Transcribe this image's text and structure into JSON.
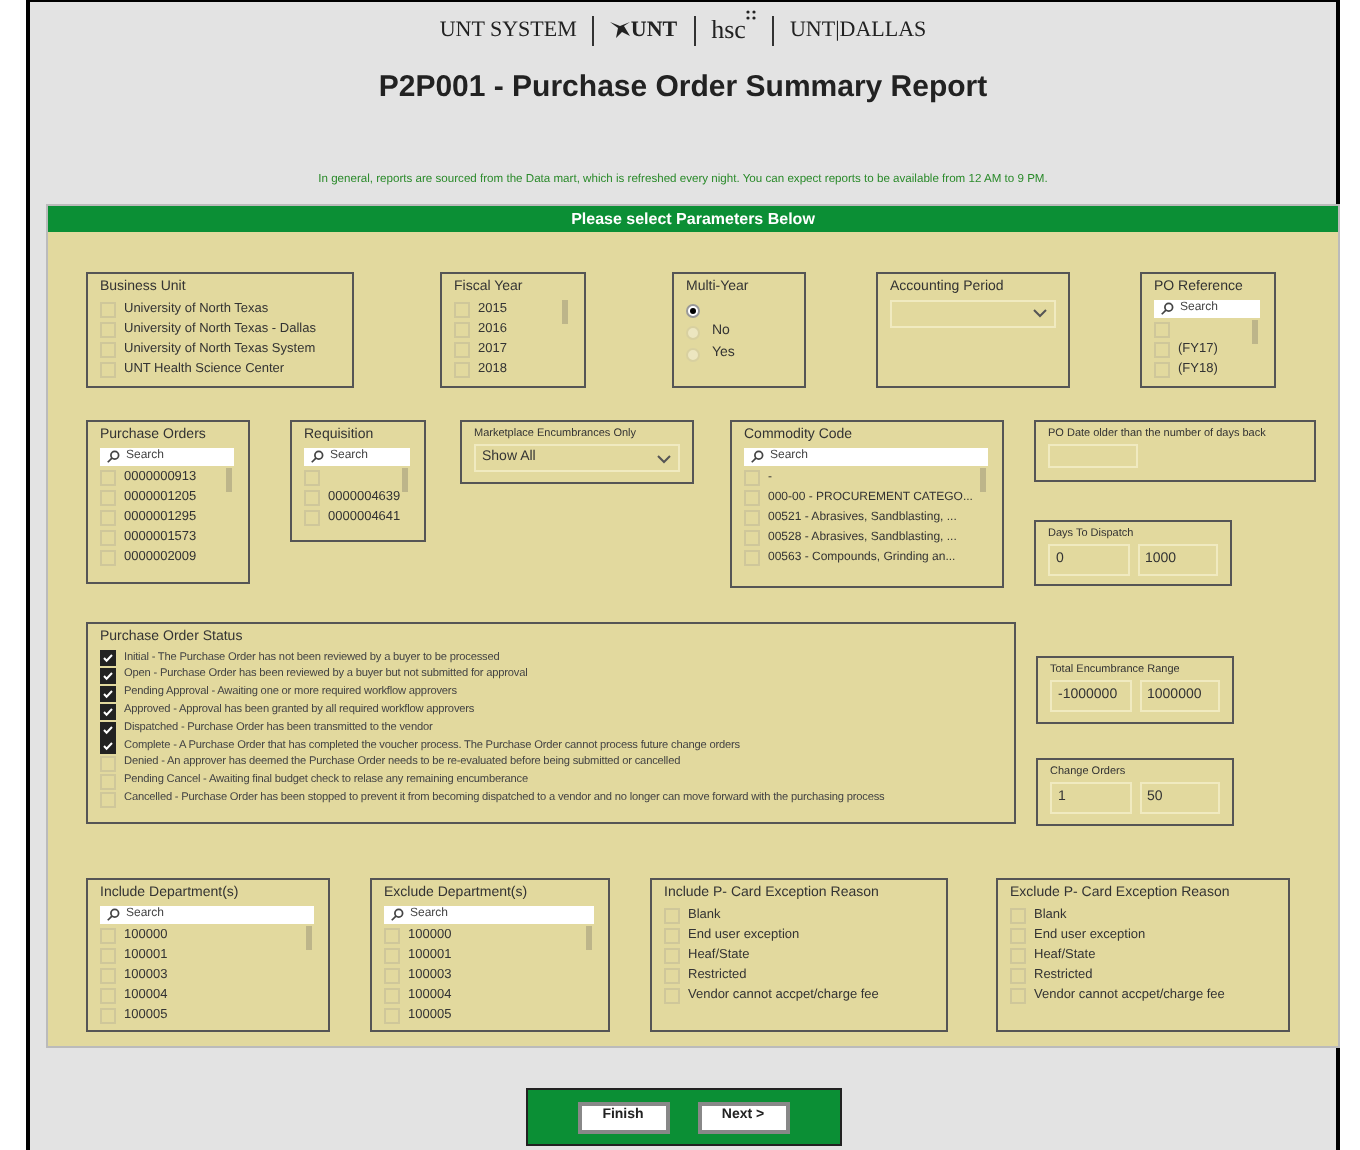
{
  "logos": [
    {
      "kind": "text",
      "text": "UNT SYSTEM"
    },
    {
      "kind": "eagle",
      "text": "UNT"
    },
    {
      "kind": "dots",
      "text": "hsc"
    },
    {
      "kind": "text",
      "text": "UNT|DALLAS"
    }
  ],
  "title": "P2P001 - Purchase Order Summary Report",
  "notice": "In general, reports are sourced from the Data mart, which is refreshed every night. You can expect reports to be available from 12 AM to 9 PM.",
  "panel": {
    "header": "Please select Parameters Below"
  },
  "rows": [
    [
      {
        "kind": "list",
        "title": "Business Unit",
        "items": [
          {
            "label": "University of North Texas",
            "checked": false
          },
          {
            "label": "University of North Texas - Dallas",
            "checked": false
          },
          {
            "label": "University of North Texas System",
            "checked": false
          },
          {
            "label": "UNT Health Science Center",
            "checked": false
          }
        ]
      },
      {
        "kind": "scroll_list",
        "title": "Fiscal Year",
        "items": [
          {
            "label": "2015",
            "checked": false
          },
          {
            "label": "2016",
            "checked": false
          },
          {
            "label": "2017",
            "checked": false
          },
          {
            "label": "2018",
            "checked": false
          }
        ]
      },
      {
        "kind": "radio",
        "title": "Multi-Year",
        "items": [
          {
            "selected": true
          },
          {
            "label": "No",
            "selected": false
          },
          {
            "label": "Yes",
            "selected": false
          }
        ]
      },
      {
        "kind": "dropdown",
        "title": "Accounting Period"
      },
      {
        "kind": "scroll_list",
        "title": "PO Reference",
        "search": "Search",
        "items": [
          {
            "checked": false
          },
          {
            "label": "(FY17)",
            "checked": false
          },
          {
            "label": "(FY18)",
            "checked": false
          }
        ]
      }
    ],
    [
      {
        "kind": "scroll_list",
        "title": "Purchase Orders",
        "search": "Search",
        "items": [
          {
            "label": "0000000913",
            "checked": false
          },
          {
            "label": "0000001205",
            "checked": false
          },
          {
            "label": "0000001295",
            "checked": false
          },
          {
            "label": "0000001573",
            "checked": false
          },
          {
            "label": "0000002009",
            "checked": false
          }
        ]
      },
      {
        "kind": "scroll_list",
        "title": "Requisition",
        "search": "Search",
        "items": [
          {
            "checked": false
          },
          {
            "label": "0000004639",
            "checked": false
          },
          {
            "label": "0000004641",
            "checked": false
          }
        ]
      },
      {
        "kind": "dropdown",
        "title": "Marketplace Encumbrances Only",
        "value": "Show All"
      },
      {
        "kind": "scroll_list",
        "title": "Commodity Code",
        "search": "Search",
        "items": [
          {
            "label": "-",
            "checked": false
          },
          {
            "label": "000-00 - PROCUREMENT CATEGO...",
            "checked": false
          },
          {
            "label": "00521 - Abrasives, Sandblasting, ...",
            "checked": false
          },
          {
            "label": "00528 - Abrasives, Sandblasting, ...",
            "checked": false
          },
          {
            "label": "00563 - Compounds, Grinding an...",
            "checked": false
          }
        ]
      },
      {
        "kind": "stack",
        "items": [
          {
            "kind": "single",
            "title": "PO Date older than the number of days back"
          },
          {
            "kind": "range",
            "title": "Days To Dispatch",
            "from": "0",
            "to": "1000"
          }
        ]
      }
    ],
    [
      {
        "kind": "list",
        "title": "Purchase Order Status",
        "items": [
          {
            "label": "Initial - The Purchase Order has not been reviewed by a buyer to be processed",
            "checked": true
          },
          {
            "label": "Open - Purchase Order has been reviewed by a buyer but not submitted for approval",
            "checked": true
          },
          {
            "label": "Pending Approval - Awaiting one or more required workflow approvers",
            "checked": true
          },
          {
            "label": "Approved - Approval has been granted by all required workflow approvers",
            "checked": true
          },
          {
            "label": "Dispatched - Purchase Order has been transmitted to the vendor",
            "checked": true
          },
          {
            "label": "Complete - A Purchase Order that has completed the voucher process. The Purchase Order cannot process future change orders",
            "checked": true
          },
          {
            "label": "Denied - An approver has deemed the Purchase Order needs to be re-evaluated before being submitted or cancelled",
            "checked": false
          },
          {
            "label": "Pending Cancel - Awaiting final budget check to relase any remaining encumberance",
            "checked": false
          },
          {
            "label": "Cancelled - Purchase Order has been stopped to prevent it from becoming dispatched to a vendor and no longer can move forward with the purchasing process",
            "checked": false
          }
        ]
      },
      {
        "kind": "stack",
        "items": [
          {
            "kind": "range",
            "title": "Total Encumbrance Range",
            "from": "-1000000",
            "to": "1000000"
          },
          {
            "kind": "range",
            "title": "Change Orders",
            "from": "1",
            "to": "50"
          }
        ]
      }
    ],
    [
      {
        "kind": "scroll_list",
        "title": "Include Department(s)",
        "search": "Search",
        "items": [
          {
            "label": "100000",
            "checked": false
          },
          {
            "label": "100001",
            "checked": false
          },
          {
            "label": "100003",
            "checked": false
          },
          {
            "label": "100004",
            "checked": false
          },
          {
            "label": "100005",
            "checked": false
          }
        ]
      },
      {
        "kind": "scroll_list",
        "title": "Exclude Department(s)",
        "search": "Search",
        "items": [
          {
            "label": "100000",
            "checked": false
          },
          {
            "label": "100001",
            "checked": false
          },
          {
            "label": "100003",
            "checked": false
          },
          {
            "label": "100004",
            "checked": false
          },
          {
            "label": "100005",
            "checked": false
          }
        ]
      },
      {
        "kind": "list",
        "title": "Include P- Card Exception Reason",
        "items": [
          {
            "label": "Blank",
            "checked": false
          },
          {
            "label": "End user exception",
            "checked": false
          },
          {
            "label": "Heaf/State",
            "checked": false
          },
          {
            "label": "Restricted",
            "checked": false
          },
          {
            "label": "Vendor cannot accpet/charge fee",
            "checked": false
          }
        ]
      },
      {
        "kind": "list",
        "title": "Exclude P- Card Exception Reason",
        "items": [
          {
            "label": "Blank",
            "checked": false
          },
          {
            "label": "End user exception",
            "checked": false
          },
          {
            "label": "Heaf/State",
            "checked": false
          },
          {
            "label": "Restricted",
            "checked": false
          },
          {
            "label": "Vendor cannot accpet/charge fee",
            "checked": false
          }
        ]
      }
    ]
  ],
  "buttons": [
    "Finish",
    "Next >"
  ]
}
